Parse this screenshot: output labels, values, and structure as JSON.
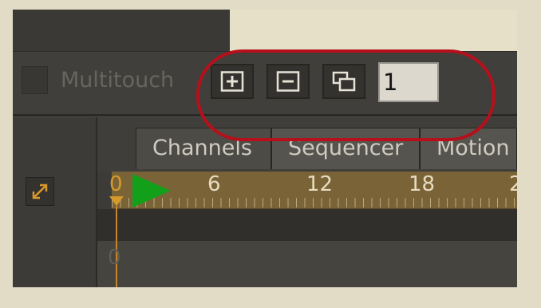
{
  "toolbar": {
    "multitouch_label": "Multitouch",
    "frame_value": "1"
  },
  "tabs": [
    {
      "label": "Channels"
    },
    {
      "label": "Sequencer"
    },
    {
      "label": "Motion"
    }
  ],
  "timeline": {
    "ruler_labels": [
      "6",
      "12",
      "18",
      "2"
    ],
    "current_frame": "0",
    "row_label": "0"
  },
  "colors": {
    "ruler": "#7a6437",
    "playhead": "#d59a2c",
    "play_marker": "#12a01a",
    "highlight_ring": "#b5101c"
  }
}
